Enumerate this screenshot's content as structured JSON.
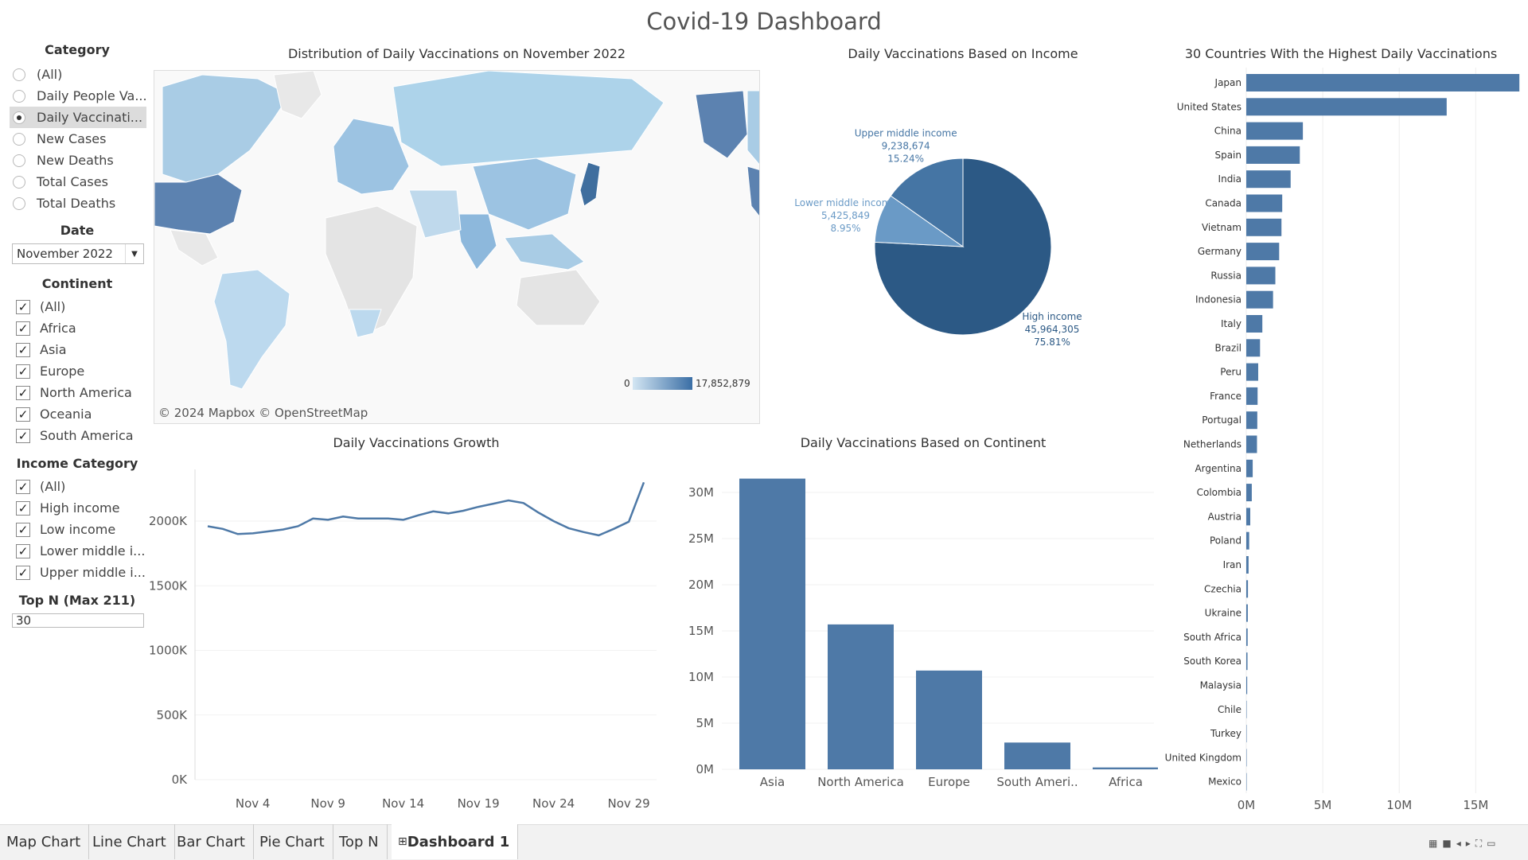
{
  "dashboard": {
    "title": "Covid-19 Dashboard"
  },
  "filters": {
    "category": {
      "title": "Category",
      "options": [
        "(All)",
        "Daily People Va...",
        "Daily Vaccinati...",
        "New Cases",
        "New Deaths",
        "Total Cases",
        "Total Deaths"
      ],
      "selected_index": 2
    },
    "date": {
      "title": "Date",
      "value": "November 2022"
    },
    "continent": {
      "title": "Continent",
      "options": [
        "(All)",
        "Africa",
        "Asia",
        "Europe",
        "North America",
        "Oceania",
        "South America"
      ]
    },
    "income": {
      "title": "Income Category",
      "options": [
        "(All)",
        "High income",
        "Low income",
        "Lower middle i...",
        "Upper middle i..."
      ]
    },
    "topn": {
      "title": "Top N (Max 211)",
      "value": "30"
    }
  },
  "map": {
    "title": "Distribution of Daily Vaccinations on November 2022",
    "credit": "© 2024 Mapbox © OpenStreetMap",
    "legend_min": "0",
    "legend_max": "17,852,879",
    "colors": {
      "low": "#d3e6f3",
      "high": "#3a6ea5",
      "nodata": "#e8e8e8"
    }
  },
  "tabs": {
    "items": [
      "Map Chart",
      "Line Chart",
      "Bar Chart",
      "Pie Chart",
      "Top N",
      "Dashboard 1"
    ],
    "active_index": 5
  },
  "chart_data": [
    {
      "type": "pie",
      "title": "Daily Vaccinations Based on Income",
      "slices": [
        {
          "label": "High income",
          "value": 45964305,
          "value_text": "45,964,305",
          "percent": "75.81%",
          "color": "#2c5985"
        },
        {
          "label": "Lower middle income",
          "value": 5425849,
          "value_text": "5,425,849",
          "percent": "8.95%",
          "color": "#6a9ac6"
        },
        {
          "label": "Upper middle income",
          "value": 9238674,
          "value_text": "9,238,674",
          "percent": "15.24%",
          "color": "#4575a4"
        }
      ]
    },
    {
      "type": "bar",
      "orientation": "horizontal",
      "title": "30 Countries With the Highest Daily Vaccinations",
      "categories": [
        "Japan",
        "United States",
        "China",
        "Spain",
        "India",
        "Canada",
        "Vietnam",
        "Germany",
        "Russia",
        "Indonesia",
        "Italy",
        "Brazil",
        "Peru",
        "France",
        "Portugal",
        "Netherlands",
        "Argentina",
        "Colombia",
        "Austria",
        "Poland",
        "Iran",
        "Czechia",
        "Ukraine",
        "South Africa",
        "South Korea",
        "Malaysia",
        "Chile",
        "Turkey",
        "United Kingdom",
        "Mexico"
      ],
      "values": [
        17852879,
        13100000,
        3700000,
        3500000,
        2900000,
        2350000,
        2300000,
        2150000,
        1900000,
        1750000,
        1050000,
        900000,
        780000,
        740000,
        720000,
        700000,
        420000,
        360000,
        260000,
        190000,
        150000,
        110000,
        100000,
        90000,
        80000,
        60000,
        20000,
        15000,
        10000,
        5000
      ],
      "xticks": [
        "0M",
        "5M",
        "10M",
        "15M"
      ],
      "xtick_values": [
        0,
        5000000,
        10000000,
        15000000
      ],
      "xlim": [
        0,
        18000000
      ],
      "color": "#4e79a7"
    },
    {
      "type": "line",
      "title": "Daily Vaccinations Growth",
      "x": [
        "Nov 1",
        "Nov 2",
        "Nov 3",
        "Nov 4",
        "Nov 5",
        "Nov 6",
        "Nov 7",
        "Nov 8",
        "Nov 9",
        "Nov 10",
        "Nov 11",
        "Nov 12",
        "Nov 13",
        "Nov 14",
        "Nov 15",
        "Nov 16",
        "Nov 17",
        "Nov 18",
        "Nov 19",
        "Nov 20",
        "Nov 21",
        "Nov 22",
        "Nov 23",
        "Nov 24",
        "Nov 25",
        "Nov 26",
        "Nov 27",
        "Nov 28",
        "Nov 29",
        "Nov 30"
      ],
      "values": [
        1960000,
        1940000,
        1900000,
        1905000,
        1920000,
        1935000,
        1960000,
        2020000,
        2010000,
        2035000,
        2020000,
        2020000,
        2020000,
        2010000,
        2045000,
        2075000,
        2060000,
        2080000,
        2110000,
        2135000,
        2160000,
        2140000,
        2065000,
        2000000,
        1945000,
        1915000,
        1890000,
        1940000,
        1995000,
        2300000
      ],
      "xticks": [
        "Nov 4",
        "Nov 9",
        "Nov 14",
        "Nov 19",
        "Nov 24",
        "Nov 29"
      ],
      "xtick_index": [
        3,
        8,
        13,
        18,
        23,
        28
      ],
      "yticks": [
        "0K",
        "500K",
        "1000K",
        "1500K",
        "2000K"
      ],
      "ytick_values": [
        0,
        500000,
        1000000,
        1500000,
        2000000
      ],
      "ylim": [
        0,
        2400000
      ],
      "color": "#4e79a7"
    },
    {
      "type": "bar",
      "title": "Daily Vaccinations Based on Continent",
      "categories": [
        "Asia",
        "North America",
        "Europe",
        "South Ameri..",
        "Africa"
      ],
      "values": [
        31500000,
        15700000,
        10700000,
        2900000,
        200000
      ],
      "yticks": [
        "0M",
        "5M",
        "10M",
        "15M",
        "20M",
        "25M",
        "30M"
      ],
      "ytick_values": [
        0,
        5000000,
        10000000,
        15000000,
        20000000,
        25000000,
        30000000
      ],
      "ylim": [
        0,
        32500000
      ],
      "color": "#4e79a7"
    }
  ]
}
